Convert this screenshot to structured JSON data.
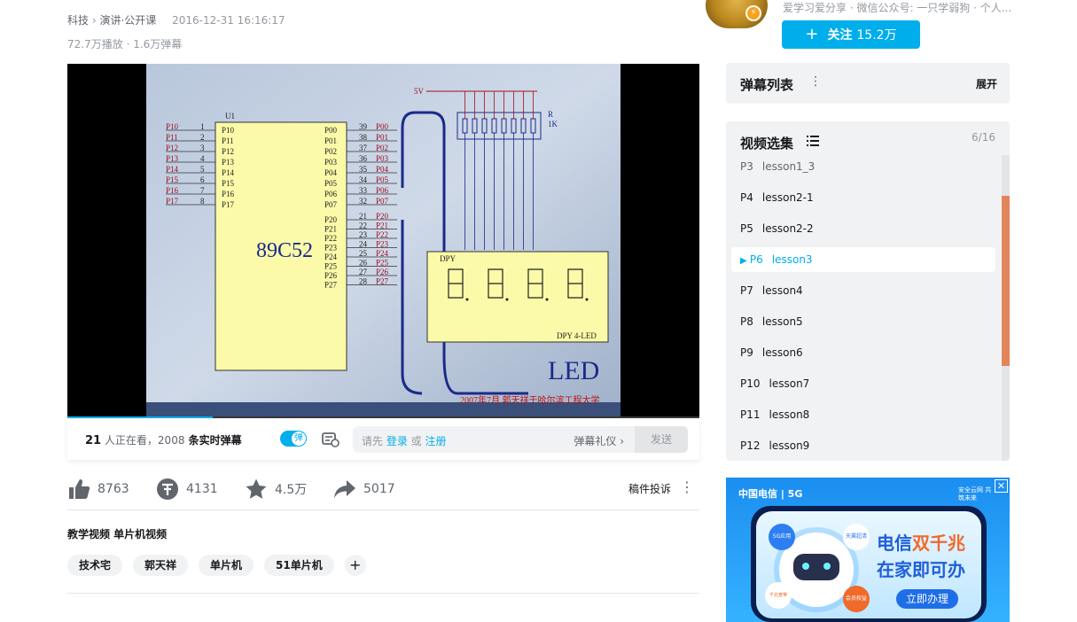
{
  "meta": {
    "category": "科技",
    "subcategory": "演讲·公开课",
    "date": "2016-12-31 16:16:17",
    "plays": "72.7万播放",
    "danmaku_total": "1.6万弹幕"
  },
  "video": {
    "schematic": {
      "chip": "89C52",
      "u_label": "U1",
      "supply": "5V",
      "resistor_label": "R",
      "resistor_value": "1K",
      "display_label": "DPY",
      "display_model": "DPY 4-LED",
      "big_label": "LED",
      "caption": "2007年7月  郭天祥于哈尔滨工程大学",
      "left_pins": [
        "P10",
        "P11",
        "P12",
        "P13",
        "P14",
        "P15",
        "P16",
        "P17"
      ],
      "left_nums": [
        "1",
        "2",
        "3",
        "4",
        "5",
        "6",
        "7",
        "8"
      ],
      "right_pins_top": [
        "P00",
        "P01",
        "P02",
        "P03",
        "P04",
        "P05",
        "P06",
        "P07"
      ],
      "right_nums_top": [
        "39",
        "38",
        "37",
        "36",
        "35",
        "34",
        "33",
        "32"
      ],
      "right_pins_mid": [
        "P20",
        "P21",
        "P22",
        "P23",
        "P24",
        "P25",
        "P26",
        "P27"
      ],
      "right_nums_mid": [
        "21",
        "22",
        "23",
        "24",
        "25",
        "26",
        "27",
        "28"
      ]
    },
    "progress": 0.23
  },
  "danmaku_bar": {
    "watching_count": "21",
    "watching_text": " 人正在看，",
    "live_count": "2008",
    "live_text": " 条实时弹幕",
    "toggle_label": "弹",
    "placeholder_prefix": "请先 ",
    "login": "登录",
    "or": " 或 ",
    "register": "注册",
    "etiquette": "弹幕礼仪 ›",
    "send": "发送"
  },
  "toolbar": {
    "like": "8763",
    "coin": "4131",
    "favorite": "4.5万",
    "share": "5017",
    "report": "稿件投诉",
    "more": "⋮"
  },
  "description": {
    "title": "教学视频 单片机视频"
  },
  "tags": [
    "技术宅",
    "郭天祥",
    "单片机",
    "51单片机"
  ],
  "tag_add": "+",
  "up": {
    "desc": "爱学习爱分享 · 微信公众号: 一只学弱狗 · 个人...",
    "follow_label": "关注",
    "follow_count": "15.2万"
  },
  "danmu_list": {
    "title": "弹幕列表",
    "dots": "⋮",
    "expand": "展开"
  },
  "episodes": {
    "title": "视频选集",
    "count": "6/16",
    "items": [
      {
        "n": "P3",
        "t": "lesson1_3"
      },
      {
        "n": "P4",
        "t": "lesson2-1"
      },
      {
        "n": "P5",
        "t": "lesson2-2"
      },
      {
        "n": "P6",
        "t": "lesson3"
      },
      {
        "n": "P7",
        "t": "lesson4"
      },
      {
        "n": "P8",
        "t": "lesson5"
      },
      {
        "n": "P9",
        "t": "lesson6"
      },
      {
        "n": "P10",
        "t": "lesson7"
      },
      {
        "n": "P11",
        "t": "lesson8"
      },
      {
        "n": "P12",
        "t": "lesson9"
      }
    ],
    "active_index": 3
  },
  "ad": {
    "brand": "中国电信 | 5G",
    "corner": "安全云网 共筑未来",
    "headline1a": "电信",
    "headline1b": "双千兆",
    "headline2": "在家即可办",
    "cta": "立即办理",
    "bubble1": "5G应用",
    "bubble2": "天翼超清",
    "bubble3": "千兆宽带",
    "bubble4": "会员权益"
  },
  "colors": {
    "accent": "#00aeec",
    "panel": "#f1f2f3",
    "scroll_thumb": "#e3855c",
    "schematic_bg": "#fafaa8",
    "wire": "#1a2a8a",
    "pin_red": "#a01020"
  }
}
